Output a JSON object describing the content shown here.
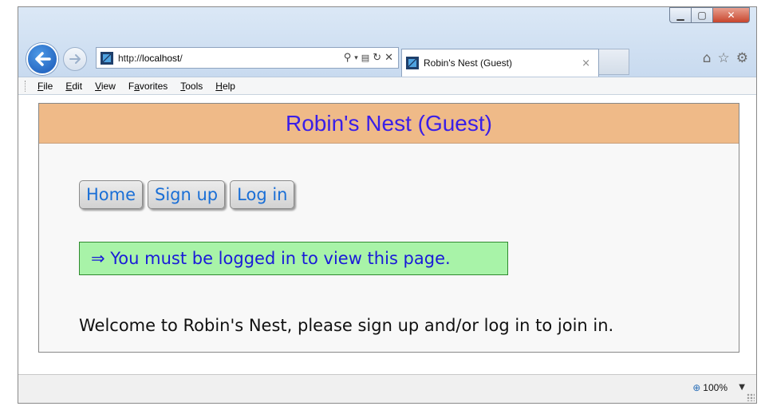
{
  "browser": {
    "address": {
      "protocol": "http://",
      "host": "localhost",
      "path": "/"
    },
    "tab": {
      "title": "Robin's Nest (Guest)",
      "close": "×"
    },
    "menu": [
      {
        "u": "F",
        "rest": "ile"
      },
      {
        "u": "E",
        "rest": "dit"
      },
      {
        "u": "V",
        "rest": "iew"
      },
      {
        "pre": "F",
        "u": "a",
        "rest": "vorites"
      },
      {
        "u": "T",
        "rest": "ools"
      },
      {
        "u": "H",
        "rest": "elp"
      }
    ],
    "status": {
      "zoom": "100%"
    },
    "icons": [
      "back-arrow-icon",
      "forward-arrow-icon",
      "search-icon",
      "compat-view-icon",
      "refresh-icon",
      "stop-icon",
      "home-icon",
      "favorites-star-icon",
      "gear-icon",
      "zoom-icon"
    ]
  },
  "page": {
    "banner_title": "Robin's Nest (Guest)",
    "nav_buttons": {
      "home": "Home",
      "signup": "Sign up",
      "login": "Log in"
    },
    "notice": "⇒ You must be logged in to view this page.",
    "welcome": "Welcome to Robin's Nest, please sign up and/or log in to join in."
  },
  "colors": {
    "banner_bg": "#efba88",
    "banner_text": "#3a1ee8",
    "button_text": "#1a6fd6",
    "notice_bg": "#a8f3a8",
    "notice_text": "#1a1ad8"
  }
}
